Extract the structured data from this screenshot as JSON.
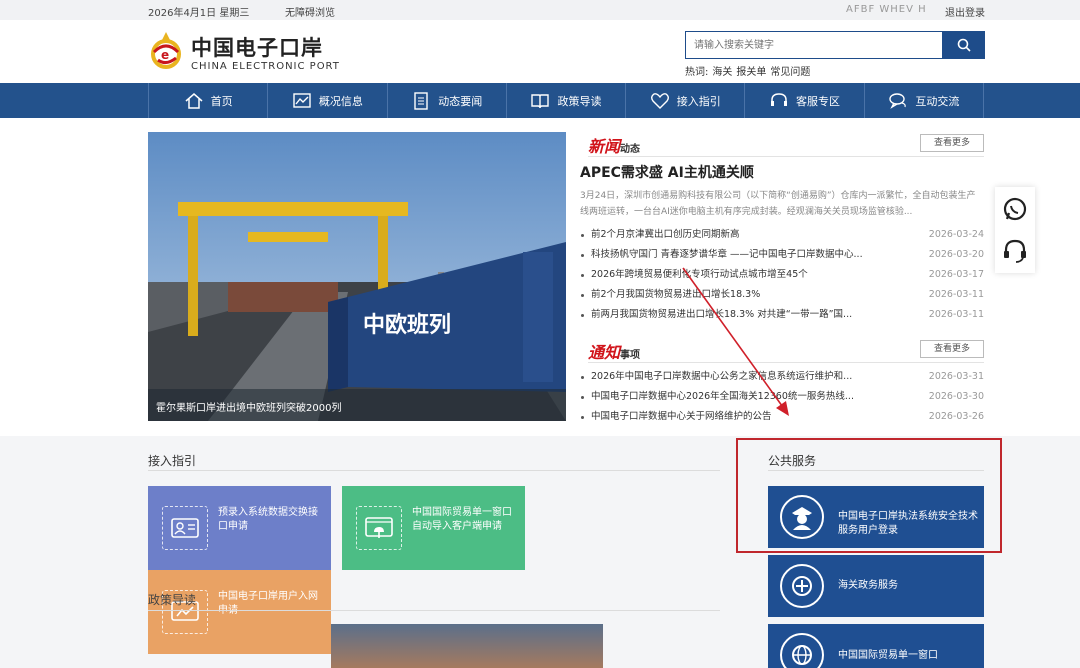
{
  "topbar": {
    "date": "2026年4月1日 星期三",
    "accessibility": "无障碍浏览",
    "user": "AFBF WHEV H",
    "logout": "退出登录"
  },
  "header": {
    "logo_cn": "中国电子口岸",
    "logo_en": "CHINA ELECTRONIC PORT",
    "search_placeholder": "请输入搜索关键字",
    "hot_label": "热词:",
    "hot_words": [
      "海关",
      "报关单",
      "常见问题"
    ]
  },
  "nav": [
    {
      "label": "首页",
      "icon": "home-icon"
    },
    {
      "label": "概况信息",
      "icon": "chart-icon"
    },
    {
      "label": "动态要闻",
      "icon": "document-icon"
    },
    {
      "label": "政策导读",
      "icon": "book-icon"
    },
    {
      "label": "接入指引",
      "icon": "heart-icon"
    },
    {
      "label": "客服专区",
      "icon": "headset-icon"
    },
    {
      "label": "互动交流",
      "icon": "chat-icon"
    }
  ],
  "photo": {
    "caption": "霍尔果斯口岸进出境中欧班列突破2000列",
    "container_text": "中欧班列"
  },
  "news": {
    "head_red": "新闻",
    "head_black": "动态",
    "more": "查看更多",
    "headline": "APEC需求盛 AI主机通关顺",
    "summary": "3月24日，深圳市创通易购科技有限公司（以下简称“创通易购”）仓库内一派繁忙，全自动包装生产线两班运转，一台台AI迷你电脑主机有序完成封装。经观澜海关关员现场监管核验...",
    "items": [
      {
        "title": "前2个月京津冀出口创历史同期新高",
        "date": "2026-03-24"
      },
      {
        "title": "科技扬帆守国门 青春逐梦谱华章 ——记中国电子口岸数据中心...",
        "date": "2026-03-20"
      },
      {
        "title": "2026年跨境贸易便利化专项行动试点城市增至45个",
        "date": "2026-03-17"
      },
      {
        "title": "前2个月我国货物贸易进出口增长18.3%",
        "date": "2026-03-11"
      },
      {
        "title": "前两月我国货物贸易进出口增长18.3% 对共建“一带一路”国...",
        "date": "2026-03-11"
      }
    ]
  },
  "notice": {
    "head_red": "通知",
    "head_black": "事项",
    "more": "查看更多",
    "items": [
      {
        "title": "2026年中国电子口岸数据中心公务之家信息系统运行维护和...",
        "date": "2026-03-31"
      },
      {
        "title": "中国电子口岸数据中心2026年全国海关12360统一服务热线...",
        "date": "2026-03-30"
      },
      {
        "title": "中国电子口岸数据中心关于网络维护的公告",
        "date": "2026-03-26"
      }
    ]
  },
  "access": {
    "title": "接入指引",
    "tiles": [
      {
        "label": "预录入系统数据交换接口申请",
        "color": "#6d7fc9"
      },
      {
        "label": "中国国际贸易单一窗口自动导入客户端申请",
        "color": "#4cbd85"
      },
      {
        "label": "中国电子口岸用户入网申请",
        "color": "#e9a264"
      }
    ]
  },
  "policy": {
    "title": "政策导读"
  },
  "public_service": {
    "title": "公共服务",
    "items": [
      {
        "label": "中国电子口岸执法系统安全技术服务用户登录"
      },
      {
        "label": "海关政务服务"
      },
      {
        "label": "中国国际贸易单一窗口"
      }
    ]
  }
}
